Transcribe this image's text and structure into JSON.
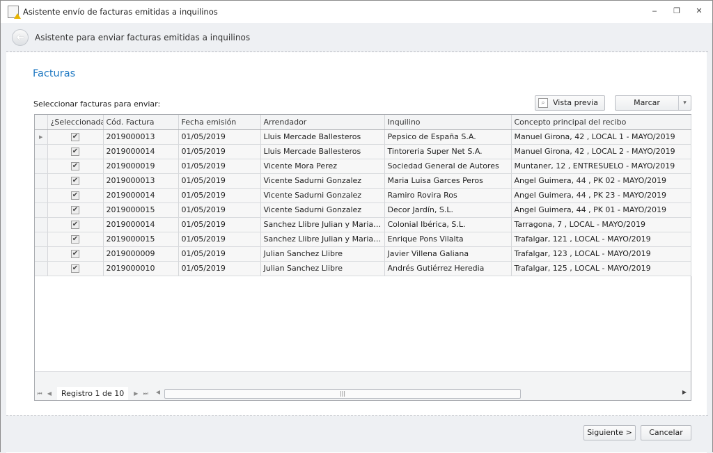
{
  "window": {
    "title": "Asistente envío de facturas emitidas a inquilinos",
    "minimize": "‒",
    "restore": "❐",
    "close": "✕"
  },
  "header": {
    "title": "Asistente para enviar facturas emitidas a inquilinos",
    "back": "➜"
  },
  "main": {
    "title": "Facturas",
    "select_label": "Seleccionar facturas para enviar:",
    "preview_button": "Vista previa",
    "mark_button": "Marcar",
    "mark_dropdown": "▾"
  },
  "grid": {
    "columns": [
      "",
      "¿Seleccionada?",
      "Cód. Factura",
      "Fecha emisión",
      "Arrendador",
      "Inquilino",
      "Concepto principal del recibo"
    ],
    "rows": [
      {
        "indicator": "▶",
        "selected": "✔",
        "code": "2019000013",
        "date": "01/05/2019",
        "landlord": "Lluis Mercade Ballesteros",
        "tenant": "Pepsico de España S.A.",
        "concept": "Manuel Girona, 42 , LOCAL 1 - MAYO/2019"
      },
      {
        "indicator": "",
        "selected": "✔",
        "code": "2019000014",
        "date": "01/05/2019",
        "landlord": "Lluis Mercade Ballesteros",
        "tenant": "Tintoreria Super Net S.A.",
        "concept": "Manuel Girona, 42 , LOCAL 2 - MAYO/2019"
      },
      {
        "indicator": "",
        "selected": "✔",
        "code": "2019000019",
        "date": "01/05/2019",
        "landlord": "Vicente Mora Perez",
        "tenant": "Sociedad General de Autores",
        "concept": "Muntaner, 12 , ENTRESUELO - MAYO/2019"
      },
      {
        "indicator": "",
        "selected": "✔",
        "code": "2019000013",
        "date": "01/05/2019",
        "landlord": "Vicente Sadurni Gonzalez",
        "tenant": "Maria Luisa Garces Peros",
        "concept": "Angel Guimera, 44 , PK 02 - MAYO/2019"
      },
      {
        "indicator": "",
        "selected": "✔",
        "code": "2019000014",
        "date": "01/05/2019",
        "landlord": "Vicente Sadurni Gonzalez",
        "tenant": "Ramiro Rovira Ros",
        "concept": "Angel Guimera, 44 , PK 23 - MAYO/2019"
      },
      {
        "indicator": "",
        "selected": "✔",
        "code": "2019000015",
        "date": "01/05/2019",
        "landlord": "Vicente Sadurni Gonzalez",
        "tenant": "Decor Jardín, S.L.",
        "concept": "Angel Guimera, 44 , PK 01 - MAYO/2019"
      },
      {
        "indicator": "",
        "selected": "✔",
        "code": "2019000014",
        "date": "01/05/2019",
        "landlord": "Sanchez Llibre Julian y Mariano C...",
        "tenant": "Colonial Ibérica, S.L.",
        "concept": "Tarragona, 7 , LOCAL - MAYO/2019"
      },
      {
        "indicator": "",
        "selected": "✔",
        "code": "2019000015",
        "date": "01/05/2019",
        "landlord": "Sanchez Llibre Julian y Mariano C...",
        "tenant": "Enrique Pons Vilalta",
        "concept": "Trafalgar, 121 , LOCAL - MAYO/2019"
      },
      {
        "indicator": "",
        "selected": "✔",
        "code": "2019000009",
        "date": "01/05/2019",
        "landlord": "Julian Sanchez Llibre",
        "tenant": "Javier Villena Galiana",
        "concept": "Trafalgar, 123 , LOCAL - MAYO/2019"
      },
      {
        "indicator": "",
        "selected": "✔",
        "code": "2019000010",
        "date": "01/05/2019",
        "landlord": "Julian Sanchez Llibre",
        "tenant": "Andrés Gutiérrez Heredia",
        "concept": "Trafalgar, 125 , LOCAL - MAYO/2019"
      }
    ],
    "navigator": {
      "first": "⏮",
      "prev": "◀",
      "record": "Registro 1 de 10",
      "next": "▶",
      "last": "⏭",
      "scroll_left": "◀",
      "scroll_right": "▶",
      "thumb": "|||"
    }
  },
  "footer": {
    "next_button": "Siguiente >",
    "cancel_button": "Cancelar"
  }
}
